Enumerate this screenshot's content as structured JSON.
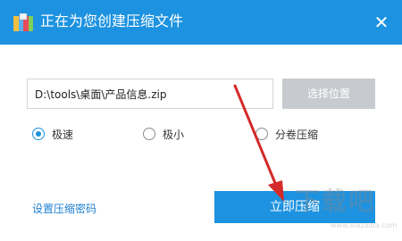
{
  "window": {
    "title": "正在为您创建压缩文件",
    "icon": "archive-icon",
    "close_glyph": "✕"
  },
  "path": {
    "value": "D:\\tools\\桌面\\产品信息.zip",
    "button_label": "选择位置"
  },
  "modes": [
    {
      "label": "极速",
      "selected": true
    },
    {
      "label": "极小",
      "selected": false
    },
    {
      "label": "分卷压缩",
      "selected": false
    }
  ],
  "footer": {
    "password_link": "设置压缩密码",
    "compress_label": "立即压缩"
  },
  "watermark": {
    "text": "下载吧",
    "url": "www.xiazaiba.com"
  },
  "colors": {
    "titlebar": "#1d92e0",
    "primary_button": "#1d92e0",
    "disabled_button": "#c7cbd0",
    "annotation_arrow": "#d42a2a"
  }
}
